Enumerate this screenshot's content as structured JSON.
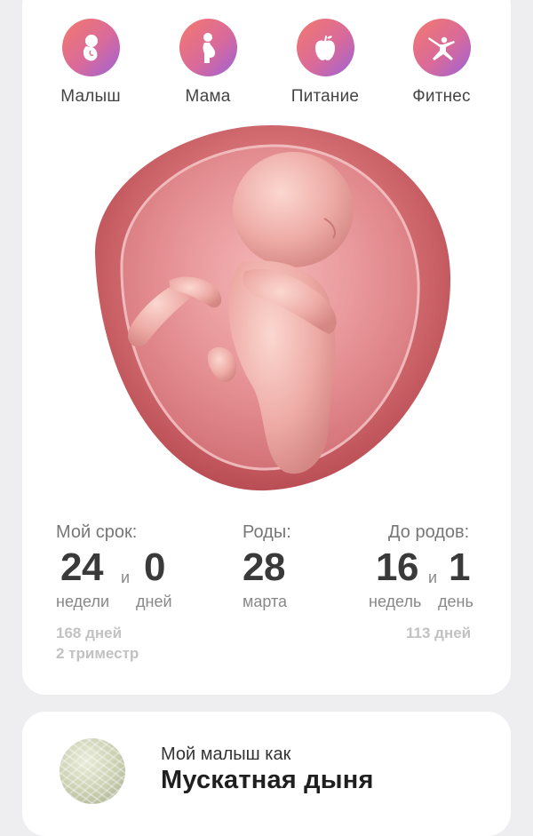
{
  "categories": [
    {
      "label": "Малыш",
      "icon": "baby-icon"
    },
    {
      "label": "Мама",
      "icon": "pregnant-woman-icon"
    },
    {
      "label": "Питание",
      "icon": "apple-icon"
    },
    {
      "label": "Фитнес",
      "icon": "fitness-icon"
    }
  ],
  "icon_gradient": [
    "#f4796c",
    "#d96a9a",
    "#9c63d7"
  ],
  "term": {
    "title": "Мой срок:",
    "weeks": "24",
    "conj": "и",
    "days": "0",
    "weeks_unit": "недели",
    "days_unit": "дней",
    "total_days": "168 дней",
    "trimester": "2 триместр"
  },
  "birth": {
    "title": "Роды:",
    "day": "28",
    "month": "марта"
  },
  "until": {
    "title": "До родов:",
    "weeks": "16",
    "conj": "и",
    "days": "1",
    "weeks_unit": "недель",
    "days_unit": "день",
    "total_days": "113 дней"
  },
  "size_card": {
    "caption": "Мой малыш как",
    "fruit": "Мускатная дыня",
    "fruit_icon": "cantaloupe-melon-icon"
  }
}
